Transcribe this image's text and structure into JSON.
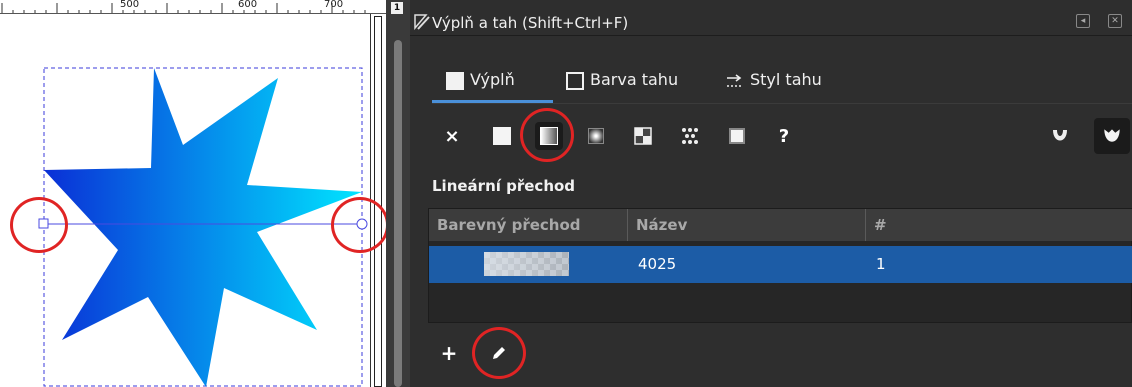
{
  "ruler": {
    "labels": [
      "500",
      "600",
      "700"
    ]
  },
  "panel": {
    "title": "Výplň a tah (Shift+Ctrl+F)",
    "pin_label": "1"
  },
  "tabs": [
    {
      "label": "Výplň",
      "icon": "filled-square-icon",
      "active": true
    },
    {
      "label": "Barva tahu",
      "icon": "outline-square-icon",
      "active": false
    },
    {
      "label": "Styl tahu",
      "icon": "stroke-style-icon",
      "active": false
    }
  ],
  "fill_types": [
    {
      "name": "no-paint",
      "symbol": "×"
    },
    {
      "name": "flat-color",
      "symbol": ""
    },
    {
      "name": "linear-gradient",
      "symbol": ""
    },
    {
      "name": "radial-gradient",
      "symbol": ""
    },
    {
      "name": "mesh-gradient",
      "symbol": ""
    },
    {
      "name": "pattern",
      "symbol": ""
    },
    {
      "name": "swatch",
      "symbol": ""
    },
    {
      "name": "unset",
      "symbol": "?"
    }
  ],
  "section": {
    "title": "Lineární přechod"
  },
  "table": {
    "headers": [
      "Barevný přechod",
      "Název",
      "#"
    ],
    "rows": [
      {
        "name": "4025",
        "count": "1"
      }
    ]
  },
  "colors": {
    "panel_bg": "#2e2e2e",
    "accent": "#4a90d9",
    "selected_row": "#1c5ca6",
    "star_start": "#0a2fd6",
    "star_end": "#00e5ff",
    "annotation": "#e02424"
  }
}
